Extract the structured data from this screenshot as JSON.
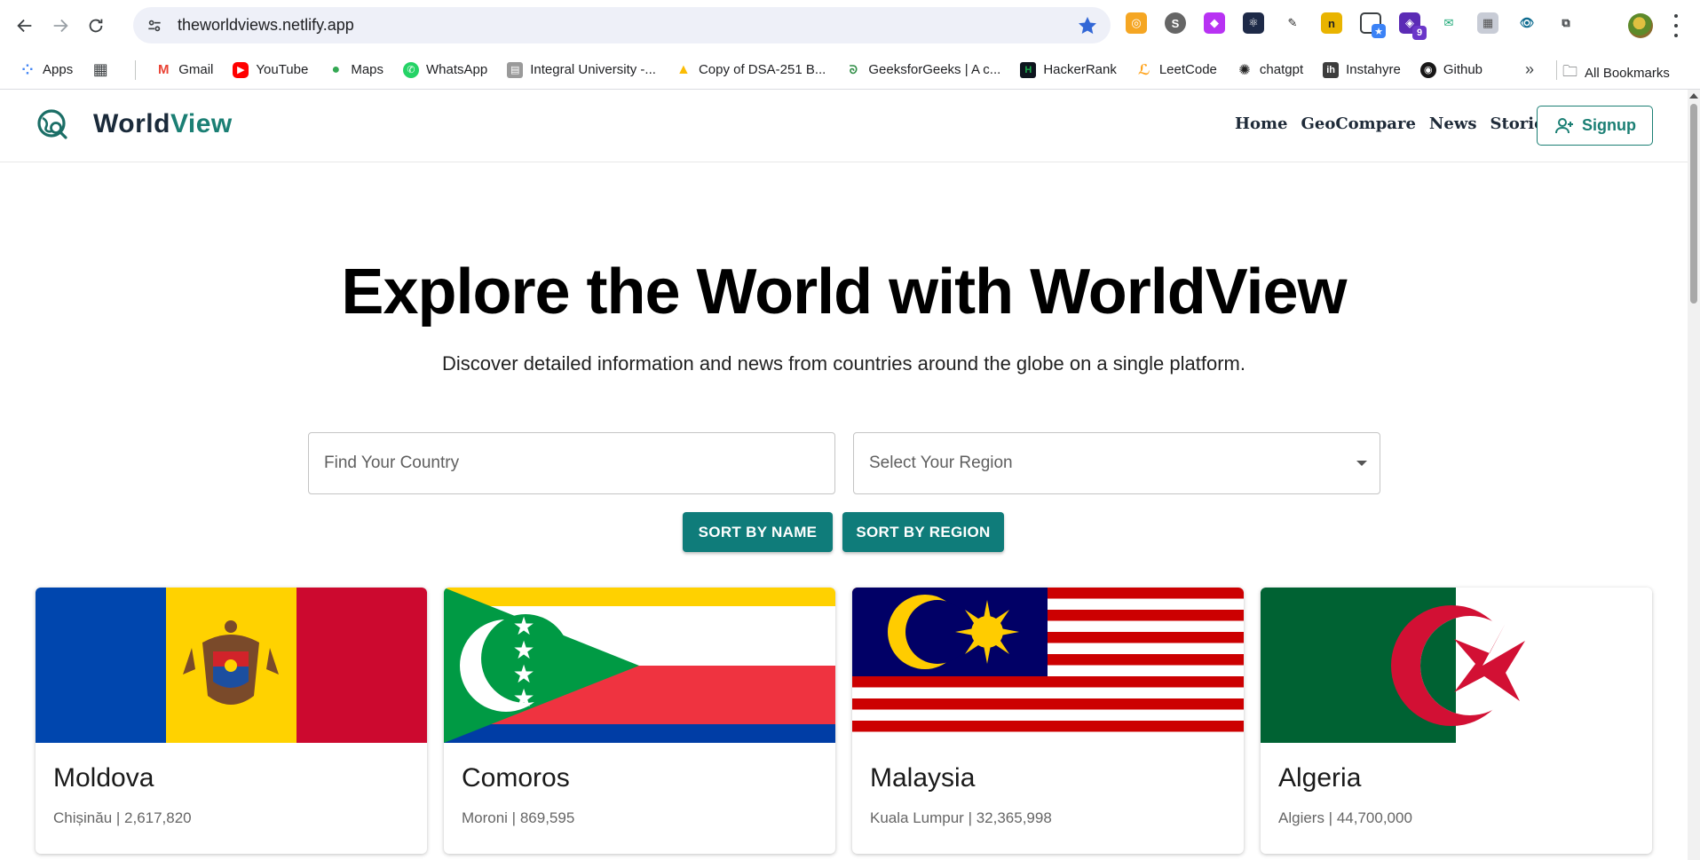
{
  "browser": {
    "url": "theworldviews.netlify.app",
    "bookmarks": [
      {
        "label": "Apps",
        "icon": "apps-grid-icon",
        "color": "#4285f4"
      },
      {
        "label": "Gmail",
        "icon": "gmail-icon",
        "color": "#ea4335"
      },
      {
        "label": "YouTube",
        "icon": "youtube-icon",
        "color": "#ff0000"
      },
      {
        "label": "Maps",
        "icon": "maps-pin-icon",
        "color": "#34a853"
      },
      {
        "label": "WhatsApp",
        "icon": "whatsapp-icon",
        "color": "#25d366"
      },
      {
        "label": "Integral University -...",
        "icon": "university-icon",
        "color": "#777777"
      },
      {
        "label": "Copy of DSA-251 B...",
        "icon": "google-drive-icon",
        "color": "#fbbc04"
      },
      {
        "label": "GeeksforGeeks | A c...",
        "icon": "geeksforgeeks-icon",
        "color": "#2f8d46"
      },
      {
        "label": "HackerRank",
        "icon": "hackerrank-icon",
        "color": "#1ba94c"
      },
      {
        "label": "LeetCode",
        "icon": "leetcode-icon",
        "color": "#ffa116"
      },
      {
        "label": "chatgpt",
        "icon": "openai-icon",
        "color": "#222222"
      },
      {
        "label": "Instahyre",
        "icon": "instahyre-icon",
        "color": "#3d3d3d"
      },
      {
        "label": "Github",
        "icon": "github-icon",
        "color": "#181717"
      }
    ],
    "all_bookmarks_label": "All Bookmarks",
    "ext_badge": "9"
  },
  "site": {
    "logo_main": "World",
    "logo_accent": "View",
    "nav": [
      "Home",
      "GeoCompare",
      "News",
      "Stories"
    ],
    "signup_label": "Signup",
    "accent_color": "#1b7f74"
  },
  "hero": {
    "title": "Explore the World with WorldView",
    "subtitle": "Discover detailed information and news from countries around the globe on a single platform."
  },
  "filters": {
    "search_placeholder": "Find Your Country",
    "region_placeholder": "Select Your Region",
    "sort_name_label": "SORT BY NAME",
    "sort_region_label": "SORT BY REGION"
  },
  "countries": [
    {
      "name": "Moldova",
      "meta": "Chișinău | 2,617,820",
      "flag": "moldova-flag"
    },
    {
      "name": "Comoros",
      "meta": "Moroni | 869,595",
      "flag": "comoros-flag"
    },
    {
      "name": "Malaysia",
      "meta": "Kuala Lumpur | 32,365,998",
      "flag": "malaysia-flag"
    },
    {
      "name": "Algeria",
      "meta": "Algiers | 44,700,000",
      "flag": "algeria-flag"
    }
  ]
}
